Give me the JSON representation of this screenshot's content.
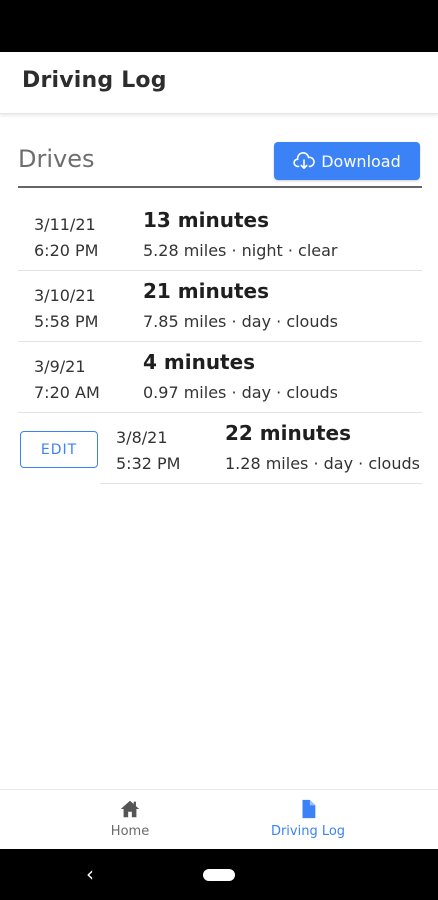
{
  "app": {
    "title": "Driving Log"
  },
  "section": {
    "title": "Drives",
    "download_label": "Download"
  },
  "drives": [
    {
      "date": "3/11/21",
      "time": "6:20 PM",
      "duration": "13 minutes",
      "details": "5.28 miles · night · clear"
    },
    {
      "date": "3/10/21",
      "time": "5:58 PM",
      "duration": "21 minutes",
      "details": "7.85 miles · day · clouds"
    },
    {
      "date": "3/9/21",
      "time": "7:20 AM",
      "duration": "4 minutes",
      "details": "0.97 miles · day · clouds"
    },
    {
      "date": "3/8/21",
      "time": "5:32 PM",
      "duration": "22 minutes",
      "details": "1.28 miles · day · clouds",
      "edit_label": "EDIT"
    }
  ],
  "bottom_nav": {
    "items": [
      {
        "label": "Home",
        "icon": "home-icon",
        "active": false
      },
      {
        "label": "Driving Log",
        "icon": "file-icon",
        "active": true
      }
    ]
  },
  "colors": {
    "accent": "#3b82f6",
    "status_bar": "#000000"
  },
  "system_nav": {
    "back_icon": "back-chevron-icon",
    "home_icon": "home-pill-icon"
  }
}
